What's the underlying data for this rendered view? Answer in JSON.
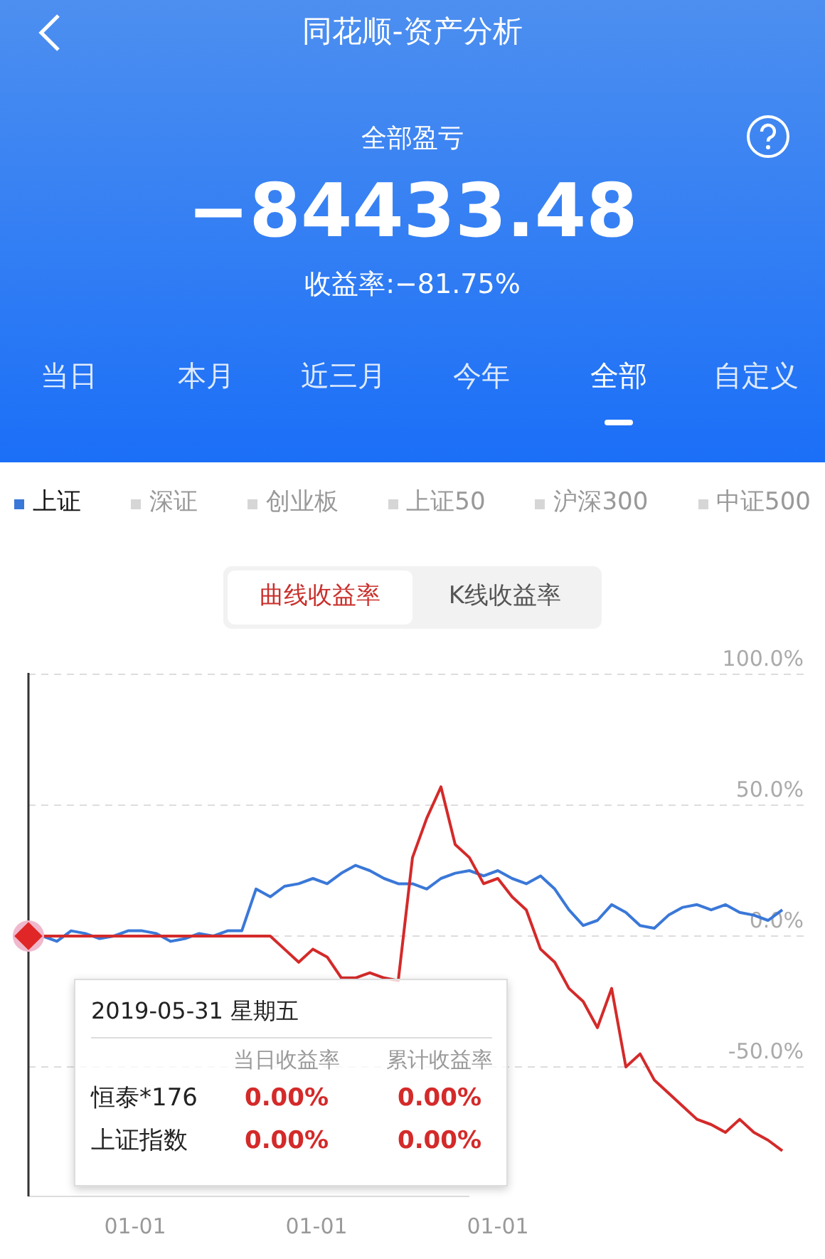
{
  "header": {
    "title": "同花顺-资产分析"
  },
  "summary": {
    "label": "全部盈亏",
    "amount": "−84433.48",
    "rate": "收益率:−81.75%"
  },
  "periods": [
    {
      "label": "当日",
      "selected": false
    },
    {
      "label": "本月",
      "selected": false
    },
    {
      "label": "近三月",
      "selected": false
    },
    {
      "label": "今年",
      "selected": false
    },
    {
      "label": "全部",
      "selected": true
    },
    {
      "label": "自定义",
      "selected": false
    }
  ],
  "indices": [
    {
      "label": "上证",
      "selected": true
    },
    {
      "label": "深证",
      "selected": false
    },
    {
      "label": "创业板",
      "selected": false
    },
    {
      "label": "上证50",
      "selected": false
    },
    {
      "label": "沪深300",
      "selected": false
    },
    {
      "label": "中证500",
      "selected": false
    }
  ],
  "chart_modes": [
    {
      "label": "曲线收益率",
      "selected": true
    },
    {
      "label": "K线收益率",
      "selected": false
    }
  ],
  "chart": {
    "chart_data": {
      "type": "line",
      "ylim": [
        -100,
        100
      ],
      "grid": true,
      "yticks": [
        {
          "value": 100,
          "label": "100.0%"
        },
        {
          "value": 50,
          "label": "50.0%"
        },
        {
          "value": 0,
          "label": "0.0%"
        },
        {
          "value": -50,
          "label": "-50.0%"
        }
      ],
      "series": [
        {
          "color": "#3a78d8",
          "values": [
            0,
            0,
            -2,
            2,
            1,
            -1,
            0,
            2,
            2,
            1,
            -2,
            -1,
            1,
            0,
            2,
            2,
            18,
            15,
            19,
            20,
            22,
            20,
            24,
            27,
            25,
            22,
            20,
            20,
            18,
            22,
            24,
            25,
            23,
            25,
            22,
            20,
            23,
            18,
            10,
            4,
            6,
            12,
            9,
            4,
            3,
            8,
            11,
            12,
            10,
            12,
            9,
            8,
            6,
            10
          ]
        },
        {
          "color": "#d42a2a",
          "values": [
            0,
            0,
            0,
            0,
            0,
            0,
            0,
            0,
            0,
            0,
            0,
            0,
            0,
            0,
            0,
            0,
            0,
            0,
            -5,
            -10,
            -5,
            -8,
            -16,
            -16,
            -14,
            -16,
            -17,
            30,
            45,
            57,
            35,
            30,
            20,
            22,
            15,
            10,
            -5,
            -10,
            -20,
            -25,
            -35,
            -20,
            -50,
            -45,
            -55,
            -60,
            -65,
            -70,
            -72,
            -75,
            -70,
            -75,
            -78,
            -82
          ]
        }
      ]
    },
    "x_labels": [
      "01-01",
      "01-01",
      "01-01"
    ],
    "tooltip": {
      "date": "2019-05-31 星期五",
      "columns": [
        "当日收益率",
        "累计收益率"
      ],
      "rows": [
        {
          "name": "恒泰*176",
          "values": [
            "0.00%",
            "0.00%"
          ]
        },
        {
          "name": "上证指数",
          "values": [
            "0.00%",
            "0.00%"
          ]
        }
      ]
    }
  }
}
